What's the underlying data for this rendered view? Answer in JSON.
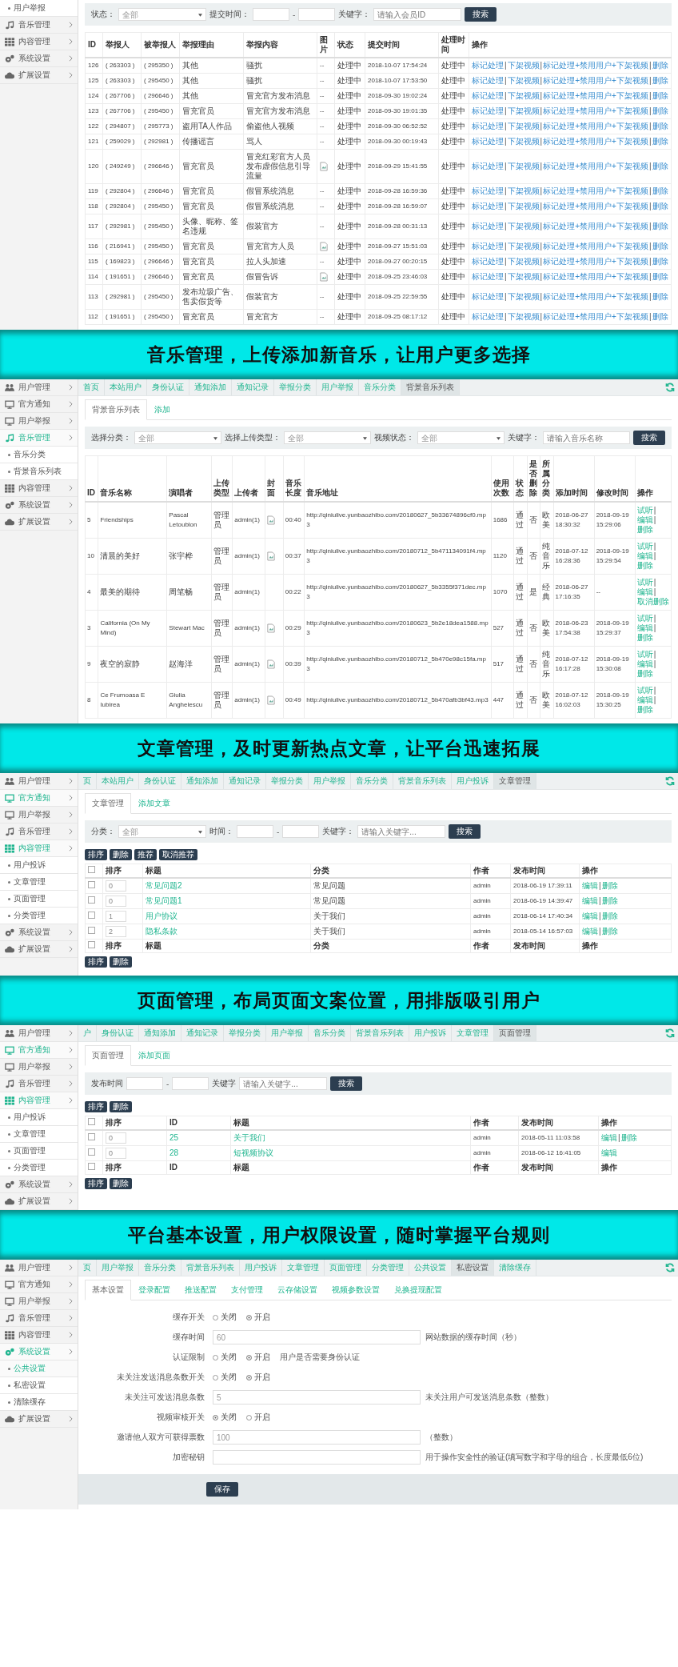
{
  "sections": [
    {
      "kind": "screen",
      "sidebar": [
        {
          "label": "用户举报",
          "kind": "sub",
          "selected": false
        },
        {
          "label": "音乐管理",
          "kind": "music",
          "selected": false
        },
        {
          "label": "内容管理",
          "kind": "grid",
          "selected": false
        },
        {
          "label": "系统设置",
          "kind": "gears",
          "selected": false
        },
        {
          "label": "扩展设置",
          "kind": "cloud",
          "selected": false
        }
      ],
      "filters": [
        {
          "kind": "select",
          "label": "状态：",
          "value": "全部"
        },
        {
          "kind": "range",
          "label": "提交时间：",
          "separator": "-"
        },
        {
          "kind": "text",
          "label": "关键字：",
          "placeholder": "请输入会员ID"
        }
      ],
      "search_button": "搜索",
      "table": {
        "kind": "reports",
        "columns": [
          "ID",
          "举报人",
          "被举报人",
          "举报理由",
          "举报内容",
          "图片",
          "状态",
          "提交时间",
          "处理时间",
          "操作"
        ],
        "rows": [
          {
            "cells": [
              "126",
              "( 263303 )",
              "( 295350 )",
              "其他",
              "骚扰",
              "--",
              "处理中",
              "2018-10-07 17:54:24",
              "处理中",
              {
                "kind": "ops",
                "links": [
                  "标记处理",
                  "下架视频",
                  "标记处理+禁用用户+下架视频",
                  "删除"
                ],
                "separator": "|"
              }
            ]
          },
          {
            "cells": [
              "125",
              "( 263303 )",
              "( 295450 )",
              "其他",
              "骚扰",
              "--",
              "处理中",
              "2018-10-07 17:53:50",
              "处理中",
              {
                "kind": "ops",
                "links": [
                  "标记处理",
                  "下架视频",
                  "标记处理+禁用用户+下架视频",
                  "删除"
                ],
                "separator": "|"
              }
            ]
          },
          {
            "cells": [
              "124",
              "( 267706 )",
              "( 296646 )",
              "其他",
              "冒充官方发布消息",
              "--",
              "处理中",
              "2018-09-30 19:02:24",
              "处理中",
              {
                "kind": "ops",
                "links": [
                  "标记处理",
                  "下架视频",
                  "标记处理+禁用用户+下架视频",
                  "删除"
                ],
                "separator": "|"
              }
            ]
          },
          {
            "cells": [
              "123",
              "( 267706 )",
              "( 295450 )",
              "冒充官员",
              "冒充官方发布消息",
              "--",
              "处理中",
              "2018-09-30 19:01:35",
              "处理中",
              {
                "kind": "ops",
                "links": [
                  "标记处理",
                  "下架视频",
                  "标记处理+禁用用户+下架视频",
                  "删除"
                ],
                "separator": "|"
              }
            ]
          },
          {
            "cells": [
              "122",
              "( 294807 )",
              "( 295773 )",
              "盗用TA人作品",
              "偷盗他人视频",
              "--",
              "处理中",
              "2018-09-30 06:52:52",
              "处理中",
              {
                "kind": "ops",
                "links": [
                  "标记处理",
                  "下架视频",
                  "标记处理+禁用用户+下架视频",
                  "删除"
                ],
                "separator": "|"
              }
            ]
          },
          {
            "cells": [
              "121",
              "( 259029 )",
              "( 292981 )",
              "传播谣言",
              "骂人",
              "--",
              "处理中",
              "2018-09-30 00:19:43",
              "处理中",
              {
                "kind": "ops",
                "links": [
                  "标记处理",
                  "下架视频",
                  "标记处理+禁用用户+下架视频",
                  "删除"
                ],
                "separator": "|"
              }
            ]
          },
          {
            "cells": [
              "120",
              "( 249249 )",
              "( 296646 )",
              "冒充官员",
              "冒充红彩官方人员发布虚假信息引导流量",
              {
                "kind": "image"
              },
              "处理中",
              "2018-09-29 15:41:55",
              "处理中",
              {
                "kind": "ops",
                "links": [
                  "标记处理",
                  "下架视频",
                  "标记处理+禁用用户+下架视频",
                  "删除"
                ],
                "separator": "|"
              }
            ]
          },
          {
            "cells": [
              "119",
              "( 292804 )",
              "( 296646 )",
              "冒充官员",
              "假冒系统消息",
              "--",
              "处理中",
              "2018-09-28 16:59:36",
              "处理中",
              {
                "kind": "ops",
                "links": [
                  "标记处理",
                  "下架视频",
                  "标记处理+禁用用户+下架视频",
                  "删除"
                ],
                "separator": "|"
              }
            ]
          },
          {
            "cells": [
              "118",
              "( 292804 )",
              "( 295450 )",
              "冒充官员",
              "假冒系统消息",
              "--",
              "处理中",
              "2018-09-28 16:59:07",
              "处理中",
              {
                "kind": "ops",
                "links": [
                  "标记处理",
                  "下架视频",
                  "标记处理+禁用用户+下架视频",
                  "删除"
                ],
                "separator": "|"
              }
            ]
          },
          {
            "cells": [
              "117",
              "( 292981 )",
              "( 295450 )",
              "头像、昵称、签名违规",
              "假装官方",
              "--",
              "处理中",
              "2018-09-28 00:31:13",
              "处理中",
              {
                "kind": "ops",
                "links": [
                  "标记处理",
                  "下架视频",
                  "标记处理+禁用用户+下架视频",
                  "删除"
                ],
                "separator": "|"
              }
            ]
          },
          {
            "cells": [
              "116",
              "( 216941 )",
              "( 295450 )",
              "冒充官员",
              "冒充官方人员",
              {
                "kind": "image"
              },
              "处理中",
              "2018-09-27 15:51:03",
              "处理中",
              {
                "kind": "ops",
                "links": [
                  "标记处理",
                  "下架视频",
                  "标记处理+禁用用户+下架视频",
                  "删除"
                ],
                "separator": "|"
              }
            ]
          },
          {
            "cells": [
              "115",
              "( 169823 )",
              "( 296646 )",
              "冒充官员",
              "拉人头加速",
              "--",
              "处理中",
              "2018-09-27 00:20:15",
              "处理中",
              {
                "kind": "ops",
                "links": [
                  "标记处理",
                  "下架视频",
                  "标记处理+禁用用户+下架视频",
                  "删除"
                ],
                "separator": "|"
              }
            ]
          },
          {
            "cells": [
              "114",
              "( 191651 )",
              "( 296646 )",
              "冒充官员",
              "假冒告诉",
              {
                "kind": "image"
              },
              "处理中",
              "2018-09-25 23:46:03",
              "处理中",
              {
                "kind": "ops",
                "links": [
                  "标记处理",
                  "下架视频",
                  "标记处理+禁用用户+下架视频",
                  "删除"
                ],
                "separator": "|"
              }
            ]
          },
          {
            "cells": [
              "113",
              "( 292981 )",
              "( 295450 )",
              "发布垃圾广告、售卖假货等",
              "假装官方",
              "--",
              "处理中",
              "2018-09-25 22:59:55",
              "处理中",
              {
                "kind": "ops",
                "links": [
                  "标记处理",
                  "下架视频",
                  "标记处理+禁用用户+下架视频",
                  "删除"
                ],
                "separator": "|"
              }
            ]
          },
          {
            "cells": [
              "112",
              "( 191651 )",
              "( 295450 )",
              "冒充官员",
              "冒充官方",
              "--",
              "处理中",
              "2018-09-25 08:17:12",
              "处理中",
              {
                "kind": "ops",
                "links": [
                  "标记处理",
                  "下架视频",
                  "标记处理+禁用用户+下架视频",
                  "删除"
                ],
                "separator": "|"
              }
            ]
          }
        ]
      }
    },
    {
      "kind": "banner",
      "text": "音乐管理，上传添加新音乐，让用户更多选择"
    },
    {
      "kind": "screen",
      "sidebar": [
        {
          "label": "用户管理",
          "kind": "users",
          "selected": false
        },
        {
          "label": "官方通知",
          "kind": "monitor",
          "selected": false
        },
        {
          "label": "用户举报",
          "kind": "monitor",
          "selected": false
        },
        {
          "label": "音乐管理",
          "kind": "music",
          "selected": true
        },
        {
          "label": "音乐分类",
          "kind": "sub",
          "selected": false
        },
        {
          "label": "背景音乐列表",
          "kind": "sub",
          "selected": false
        },
        {
          "label": "内容管理",
          "kind": "grid",
          "selected": false
        },
        {
          "label": "系统设置",
          "kind": "gears",
          "selected": false
        },
        {
          "label": "扩展设置",
          "kind": "cloud",
          "selected": false
        }
      ],
      "topbar": [
        {
          "label": "首页",
          "selected": false
        },
        {
          "label": "本站用户",
          "selected": false
        },
        {
          "label": "身份认证",
          "selected": false
        },
        {
          "label": "通知添加",
          "selected": false
        },
        {
          "label": "通知记录",
          "selected": false
        },
        {
          "label": "举报分类",
          "selected": false
        },
        {
          "label": "用户举报",
          "selected": false
        },
        {
          "label": "音乐分类",
          "selected": false
        },
        {
          "label": "背景音乐列表",
          "selected": true
        }
      ],
      "page_tabs": [
        {
          "label": "背景音乐列表",
          "selected": true
        },
        {
          "label": "添加",
          "selected": false
        }
      ],
      "filters": [
        {
          "kind": "select",
          "label": "选择分类：",
          "value": "全部"
        },
        {
          "kind": "select",
          "label": "选择上传类型：",
          "value": "全部"
        },
        {
          "kind": "select",
          "label": "视频状态：",
          "value": "全部"
        },
        {
          "kind": "text",
          "label": "关键字：",
          "placeholder": "请输入音乐名称"
        }
      ],
      "search_button": "搜索",
      "table": {
        "kind": "music",
        "columns": [
          "ID",
          "音乐名称",
          "演唱者",
          "上传类型",
          "上传者",
          "封面",
          "音乐长度",
          "音乐地址",
          "使用次数",
          "状态",
          "是否删除",
          "所属分类",
          "添加时间",
          "修改时间",
          "操作"
        ],
        "rows": [
          {
            "cells": [
              "5",
              "Friendships",
              "Pascal Letoublon",
              "管理员",
              "admin(1)",
              {
                "kind": "image"
              },
              "00:40",
              "http://qiniulive.yunbaozhibo.com/20180627_5b33674896cf0.mp3",
              "1686",
              "通过",
              "否",
              "欧美",
              "2018-06-27 18:30:32",
              "2018-09-19 15:29:06",
              {
                "kind": "ops",
                "links": [
                  "试听",
                  "编辑",
                  "删除"
                ],
                "separator": "|"
              }
            ]
          },
          {
            "cells": [
              "10",
              "清晨的美好",
              "张宇桦",
              "管理员",
              "admin(1)",
              {
                "kind": "image"
              },
              "00:37",
              "http://qiniulive.yunbaozhibo.com/20180712_5b471134091f4.mp3",
              "1120",
              "通过",
              "否",
              "纯音乐",
              "2018-07-12 16:28:36",
              "2018-09-19 15:29:54",
              {
                "kind": "ops",
                "links": [
                  "试听",
                  "编辑",
                  "删除"
                ],
                "separator": "|"
              }
            ]
          },
          {
            "cells": [
              "4",
              "最美的期待",
              "周笔畅",
              "管理员",
              "admin(1)",
              null,
              "00:22",
              "http://qiniulive.yunbaozhibo.com/20180627_5b3355f371dec.mp3",
              "1070",
              "通过",
              "是",
              "经典",
              "2018-06-27 17:16:35",
              "--",
              {
                "kind": "ops",
                "links": [
                  "试听",
                  "编辑",
                  "取消删除"
                ],
                "separator": "|"
              }
            ]
          },
          {
            "cells": [
              "3",
              "California (On My Mind)",
              "Stewart Mac",
              "管理员",
              "admin(1)",
              {
                "kind": "image"
              },
              "00:29",
              "http://qiniulive.yunbaozhibo.com/20180623_5b2e18dea1588.mp3",
              "527",
              "通过",
              "否",
              "欧美",
              "2018-06-23 17:54:38",
              "2018-09-19 15:29:37",
              {
                "kind": "ops",
                "links": [
                  "试听",
                  "编辑",
                  "删除"
                ],
                "separator": "|"
              }
            ]
          },
          {
            "cells": [
              "9",
              "夜空的寂静",
              "赵海洋",
              "管理员",
              "admin(1)",
              {
                "kind": "image"
              },
              "00:39",
              "http://qiniulive.yunbaozhibo.com/20180712_5b470e98c15fa.mp3",
              "517",
              "通过",
              "否",
              "纯音乐",
              "2018-07-12 16:17:28",
              "2018-09-19 15:30:08",
              {
                "kind": "ops",
                "links": [
                  "试听",
                  "编辑",
                  "删除"
                ],
                "separator": "|"
              }
            ]
          },
          {
            "cells": [
              "8",
              "Ce Frumoasa E Iubirea",
              "Giulia Anghelescu",
              "管理员",
              "admin(1)",
              {
                "kind": "image"
              },
              "00:49",
              "http://qiniulive.yunbaozhibo.com/20180712_5b470afb3bf43.mp3",
              "447",
              "通过",
              "否",
              "欧美",
              "2018-07-12 16:02:03",
              "2018-09-19 15:30:25",
              {
                "kind": "ops",
                "links": [
                  "试听",
                  "编辑",
                  "删除"
                ],
                "separator": "|"
              }
            ]
          }
        ]
      }
    },
    {
      "kind": "banner",
      "text": "文章管理，及时更新热点文章，让平台迅速拓展"
    },
    {
      "kind": "screen",
      "sidebar": [
        {
          "label": "用户管理",
          "kind": "users",
          "selected": false
        },
        {
          "label": "官方通知",
          "kind": "monitor",
          "selected": true
        },
        {
          "label": "用户举报",
          "kind": "monitor",
          "selected": false
        },
        {
          "label": "音乐管理",
          "kind": "music",
          "selected": false
        },
        {
          "label": "内容管理",
          "kind": "grid",
          "selected": true
        },
        {
          "label": "用户投诉",
          "kind": "sub",
          "selected": false
        },
        {
          "label": "文章管理",
          "kind": "sub",
          "selected": false
        },
        {
          "label": "页面管理",
          "kind": "sub",
          "selected": false
        },
        {
          "label": "分类管理",
          "kind": "sub",
          "selected": false
        },
        {
          "label": "系统设置",
          "kind": "gears",
          "selected": false
        },
        {
          "label": "扩展设置",
          "kind": "cloud",
          "selected": false
        }
      ],
      "topbar": [
        {
          "label": "页",
          "selected": false
        },
        {
          "label": "本站用户",
          "selected": false
        },
        {
          "label": "身份认证",
          "selected": false
        },
        {
          "label": "通知添加",
          "selected": false
        },
        {
          "label": "通知记录",
          "selected": false
        },
        {
          "label": "举报分类",
          "selected": false
        },
        {
          "label": "用户举报",
          "selected": false
        },
        {
          "label": "音乐分类",
          "selected": false
        },
        {
          "label": "背景音乐列表",
          "selected": false
        },
        {
          "label": "用户投诉",
          "selected": false
        },
        {
          "label": "文章管理",
          "selected": true
        }
      ],
      "page_tabs": [
        {
          "label": "文章管理",
          "selected": true
        },
        {
          "label": "添加文章",
          "selected": false
        }
      ],
      "filters": [
        {
          "kind": "select",
          "label": "分类：",
          "value": "全部"
        },
        {
          "kind": "range",
          "label": "时间：",
          "separator": "-"
        },
        {
          "kind": "text",
          "label": "关键字：",
          "placeholder": "请输入关键字..."
        }
      ],
      "search_button": "搜索",
      "actions": [
        "排序",
        "删除",
        "推荐",
        "取消推荐"
      ],
      "table": {
        "kind": "articles",
        "columns": [
          {
            "kind": "checkbox",
            "checked": false
          },
          "排序",
          "标题",
          "分类",
          "作者",
          "发布时间",
          "操作"
        ],
        "rows": [
          {
            "cells": [
              {
                "kind": "checkbox",
                "checked": false
              },
              {
                "kind": "order",
                "value": "0"
              },
              {
                "kind": "link",
                "text": "常见问题2"
              },
              "常见问题",
              "admin",
              "2018-06-19 17:39:11",
              {
                "kind": "ops",
                "links": [
                  "编辑",
                  "删除"
                ],
                "separator": "|"
              }
            ]
          },
          {
            "cells": [
              {
                "kind": "checkbox",
                "checked": false
              },
              {
                "kind": "order",
                "value": "0"
              },
              {
                "kind": "link",
                "text": "常见问题1"
              },
              "常见问题",
              "admin",
              "2018-06-19 14:39:47",
              {
                "kind": "ops",
                "links": [
                  "编辑",
                  "删除"
                ],
                "separator": "|"
              }
            ]
          },
          {
            "cells": [
              {
                "kind": "checkbox",
                "checked": false
              },
              {
                "kind": "order",
                "value": "1"
              },
              {
                "kind": "link",
                "text": "用户协议"
              },
              "关于我们",
              "admin",
              "2018-06-14 17:40:34",
              {
                "kind": "ops",
                "links": [
                  "编辑",
                  "删除"
                ],
                "separator": "|"
              }
            ]
          },
          {
            "cells": [
              {
                "kind": "checkbox",
                "checked": false
              },
              {
                "kind": "order",
                "value": "2"
              },
              {
                "kind": "link",
                "text": "隐私条款"
              },
              "关于我们",
              "admin",
              "2018-05-14 16:57:03",
              {
                "kind": "ops",
                "links": [
                  "编辑",
                  "删除"
                ],
                "separator": "|"
              }
            ]
          }
        ],
        "footer": [
          {
            "kind": "checkbox",
            "checked": false
          },
          "排序",
          "标题",
          "分类",
          "作者",
          "发布时间",
          "操作"
        ]
      },
      "bottom_actions": [
        "排序",
        "删除"
      ]
    },
    {
      "kind": "banner",
      "text": "页面管理，布局页面文案位置，用排版吸引用户"
    },
    {
      "kind": "screen",
      "sidebar": [
        {
          "label": "用户管理",
          "kind": "users",
          "selected": false
        },
        {
          "label": "官方通知",
          "kind": "monitor",
          "selected": true
        },
        {
          "label": "用户举报",
          "kind": "monitor",
          "selected": false
        },
        {
          "label": "音乐管理",
          "kind": "music",
          "selected": false
        },
        {
          "label": "内容管理",
          "kind": "grid",
          "selected": true
        },
        {
          "label": "用户投诉",
          "kind": "sub",
          "selected": false
        },
        {
          "label": "文章管理",
          "kind": "sub",
          "selected": false
        },
        {
          "label": "页面管理",
          "kind": "sub",
          "selected": false
        },
        {
          "label": "分类管理",
          "kind": "sub",
          "selected": false
        },
        {
          "label": "系统设置",
          "kind": "gears",
          "selected": false
        },
        {
          "label": "扩展设置",
          "kind": "cloud",
          "selected": false
        }
      ],
      "topbar": [
        {
          "label": "户",
          "selected": false
        },
        {
          "label": "身份认证",
          "selected": false
        },
        {
          "label": "通知添加",
          "selected": false
        },
        {
          "label": "通知记录",
          "selected": false
        },
        {
          "label": "举报分类",
          "selected": false
        },
        {
          "label": "用户举报",
          "selected": false
        },
        {
          "label": "音乐分类",
          "selected": false
        },
        {
          "label": "背景音乐列表",
          "selected": false
        },
        {
          "label": "用户投诉",
          "selected": false
        },
        {
          "label": "文章管理",
          "selected": false
        },
        {
          "label": "页面管理",
          "selected": true
        }
      ],
      "page_tabs": [
        {
          "label": "页面管理",
          "selected": true
        },
        {
          "label": "添加页面",
          "selected": false
        }
      ],
      "filters": [
        {
          "kind": "range",
          "label": "发布时间",
          "separator": "-"
        },
        {
          "kind": "text",
          "label": "关键字",
          "placeholder": "请输入关键字..."
        }
      ],
      "search_button": "搜索",
      "actions": [
        "排序",
        "删除"
      ],
      "table": {
        "kind": "pages",
        "columns": [
          {
            "kind": "checkbox",
            "checked": false
          },
          "排序",
          "ID",
          "标题",
          "作者",
          "发布时间",
          "操作"
        ],
        "rows": [
          {
            "cells": [
              {
                "kind": "checkbox",
                "checked": false
              },
              {
                "kind": "order",
                "value": "0"
              },
              {
                "kind": "link",
                "text": "25"
              },
              {
                "kind": "link",
                "text": "关于我们"
              },
              "admin",
              "2018-05-11 11:03:58",
              {
                "kind": "ops",
                "links": [
                  "编辑",
                  "删除"
                ],
                "separator": "|"
              }
            ]
          },
          {
            "cells": [
              {
                "kind": "checkbox",
                "checked": false
              },
              {
                "kind": "order",
                "value": "0"
              },
              {
                "kind": "link",
                "text": "28"
              },
              {
                "kind": "link",
                "text": "短视频协议"
              },
              "admin",
              "2018-06-12 16:41:05",
              {
                "kind": "ops",
                "links": [
                  "编辑"
                ]
              }
            ]
          }
        ],
        "footer": [
          {
            "kind": "checkbox",
            "checked": false
          },
          "排序",
          "ID",
          "标题",
          "作者",
          "发布时间",
          "操作"
        ]
      },
      "bottom_actions": [
        "排序",
        "删除"
      ]
    },
    {
      "kind": "banner",
      "text": "平台基本设置，用户权限设置，随时掌握平台规则"
    },
    {
      "kind": "screen",
      "sidebar": [
        {
          "label": "用户管理",
          "kind": "users",
          "selected": false
        },
        {
          "label": "官方通知",
          "kind": "monitor",
          "selected": false
        },
        {
          "label": "用户举报",
          "kind": "monitor",
          "selected": false
        },
        {
          "label": "音乐管理",
          "kind": "music",
          "selected": false
        },
        {
          "label": "内容管理",
          "kind": "grid",
          "selected": false
        },
        {
          "label": "系统设置",
          "kind": "gears",
          "selected": true
        },
        {
          "label": "公共设置",
          "kind": "sub",
          "selected": true
        },
        {
          "label": "私密设置",
          "kind": "sub",
          "selected": false
        },
        {
          "label": "清除缓存",
          "kind": "sub",
          "selected": false
        },
        {
          "label": "扩展设置",
          "kind": "cloud",
          "selected": false
        }
      ],
      "topbar": [
        {
          "label": "页",
          "selected": false
        },
        {
          "label": "用户举报",
          "selected": false
        },
        {
          "label": "音乐分类",
          "selected": false
        },
        {
          "label": "背景音乐列表",
          "selected": false
        },
        {
          "label": "用户投诉",
          "selected": false
        },
        {
          "label": "文章管理",
          "selected": false
        },
        {
          "label": "页面管理",
          "selected": false
        },
        {
          "label": "分类管理",
          "selected": false
        },
        {
          "label": "公共设置",
          "selected": false
        },
        {
          "label": "私密设置",
          "selected": true
        },
        {
          "label": "清除缓存",
          "selected": false
        }
      ],
      "page_tabs": [
        {
          "label": "基本设置",
          "selected": true
        },
        {
          "label": "登录配置",
          "selected": false
        },
        {
          "label": "推送配置",
          "selected": false
        },
        {
          "label": "支付管理",
          "selected": false
        },
        {
          "label": "云存储设置",
          "selected": false
        },
        {
          "label": "视频参数设置",
          "selected": false
        },
        {
          "label": "兑换提现配置",
          "selected": false
        }
      ],
      "form": {
        "rows": [
          {
            "label": "缓存开关",
            "kind": "radio",
            "options": [
              {
                "label": "关闭",
                "selected": false
              },
              {
                "label": "开启",
                "selected": true
              }
            ]
          },
          {
            "label": "缓存时间",
            "kind": "input",
            "value": "60",
            "hint": "网站数据的缓存时间（秒）"
          },
          {
            "label": "认证限制",
            "kind": "radio",
            "options": [
              {
                "label": "关闭",
                "selected": false
              },
              {
                "label": "开启",
                "selected": true
              }
            ],
            "hint": "用户是否需要身份认证"
          },
          {
            "label": "未关注发送消息条数开关",
            "kind": "radio",
            "options": [
              {
                "label": "关闭",
                "selected": false
              },
              {
                "label": "开启",
                "selected": true
              }
            ]
          },
          {
            "label": "未关注可发送消息条数",
            "kind": "input",
            "value": "5",
            "hint": "未关注用户可发送消息条数（整数）"
          },
          {
            "label": "视频审核开关",
            "kind": "radio",
            "options": [
              {
                "label": "关闭",
                "selected": true
              },
              {
                "label": "开启",
                "selected": false
              }
            ]
          },
          {
            "label": "邀请他人双方可获得票数",
            "kind": "input",
            "value": "100",
            "hint": "（整数）"
          },
          {
            "label": "加密秘钥",
            "kind": "input",
            "hint": "用于操作安全性的验证(填写数字和字母的组合，长度最低6位)"
          }
        ],
        "save": "保存"
      }
    }
  ]
}
